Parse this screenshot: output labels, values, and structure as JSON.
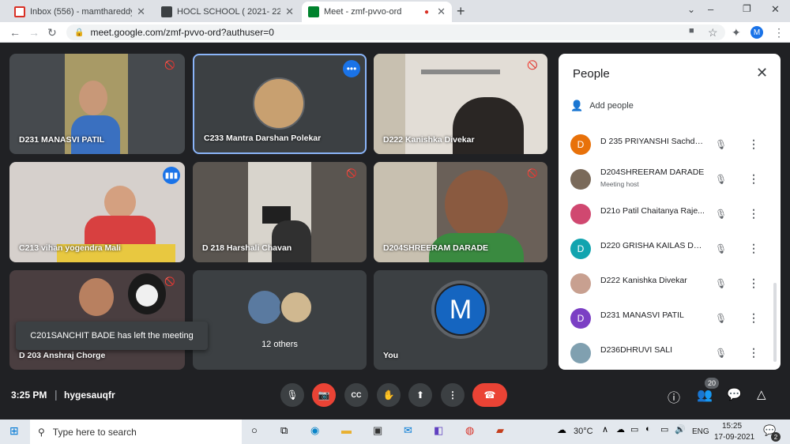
{
  "tabs": [
    {
      "label": "Inbox (556) - mamthareddy@me...",
      "icon": "gmail-icon",
      "color": "#d93025"
    },
    {
      "label": "HOCL SCHOOL ( 2021- 22) CLAS...",
      "icon": "classroom-icon",
      "color": "#1e8e3e"
    },
    {
      "label": "Meet - zmf-pvvo-ord",
      "icon": "meet-icon",
      "color": "#00832d"
    }
  ],
  "browser": {
    "url": "meet.google.com/zmf-pvvo-ord?authuser=0",
    "profile": "M"
  },
  "tiles": [
    {
      "name": "D231 MANASVI PATIL",
      "bg": "#8a7a4c"
    },
    {
      "name": "C233 Mantra Darshan Polekar",
      "bg": "#3c4043"
    },
    {
      "name": "D222 Kanishka Divekar",
      "bg": "#b8b0a0"
    },
    {
      "name": "C213 vihan yogendra Mali",
      "bg": "#c8c2c0"
    },
    {
      "name": "D 218 Harshali Chavan",
      "bg": "#8a8478"
    },
    {
      "name": "D204SHREERAM DARADE",
      "bg": "#5a5040"
    },
    {
      "name": "D 203 Anshraj Chorge",
      "bg": "#6a5a58"
    },
    {
      "name": "12 others",
      "bg": "#3c4043"
    },
    {
      "name": "You",
      "bg": "#3c4043"
    }
  ],
  "self": {
    "initial": "M",
    "color": "#1565c0"
  },
  "toast": "C201SANCHIT BADE has left the meeting",
  "people": {
    "title": "People",
    "add": "Add people",
    "list": [
      {
        "name": "D 235 PRIYANSHI Sachdeva",
        "initial": "D",
        "color": "#e8710a",
        "sub": ""
      },
      {
        "name": "D204SHREERAM DARADE",
        "initial": "",
        "color": "#7a6a5a",
        "sub": "Meeting host"
      },
      {
        "name": "D21o Patil Chaitanya Raje...",
        "initial": "",
        "color": "#d04870",
        "sub": ""
      },
      {
        "name": "D220 GRISHA KAILAS DH...",
        "initial": "D",
        "color": "#12a4af",
        "sub": ""
      },
      {
        "name": "D222 Kanishka Divekar",
        "initial": "",
        "color": "#c8a090",
        "sub": ""
      },
      {
        "name": "D231 MANASVI PATIL",
        "initial": "D",
        "color": "#7b3fc4",
        "sub": ""
      },
      {
        "name": "D236DHRUVI SALI",
        "initial": "",
        "color": "#80a0b0",
        "sub": ""
      }
    ]
  },
  "bottom": {
    "time": "3:25 PM",
    "code": "hygesauqfr",
    "participants": "20"
  },
  "taskbar": {
    "search": "Type here to search",
    "temp": "30°C",
    "lang": "ENG",
    "time": "15:25",
    "date": "17-09-2021",
    "notif": "2"
  }
}
